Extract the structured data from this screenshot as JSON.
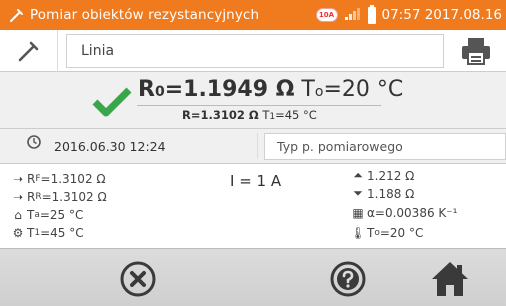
{
  "statusbar": {
    "title": "Pomiar obiektów rezystancyjnych",
    "current_badge": "10A",
    "clock": "07:57 2017.08.16"
  },
  "name_field": {
    "value": "Linia"
  },
  "result": {
    "r0_label": "R",
    "r0_sub": "0",
    "r0_value": "=1.1949 Ω",
    "t0_label": "T",
    "t0_sub": "o",
    "t0_value": "=20 °C",
    "r1_label": "R=1.3102 Ω",
    "t1_label": "T",
    "t1_sub": "1",
    "t1_value": "=45 °C"
  },
  "date": "2016.06.30 12:24",
  "measurement_type_placeholder": "Typ p. pomiarowego",
  "params": {
    "rf_label": "R",
    "rf_sub": "F",
    "rf_value": "=1.3102 Ω",
    "rr_label": "R",
    "rr_sub": "R",
    "rr_value": "=1.3102 Ω",
    "ta_label": "T",
    "ta_sub": "a",
    "ta_value": "=25 °C",
    "t1_label": "T",
    "t1_sub": "1",
    "t1_value": "=45 °C",
    "current": "I = 1 A",
    "r_top": "1.212 Ω",
    "r_bottom": "1.188 Ω",
    "alpha": "α=0.00386 K⁻¹",
    "to_label": "T",
    "to_sub": "o",
    "to_value": "=20 °C"
  },
  "colors": {
    "accent": "#f07a1e",
    "check": "#3aa64a"
  }
}
